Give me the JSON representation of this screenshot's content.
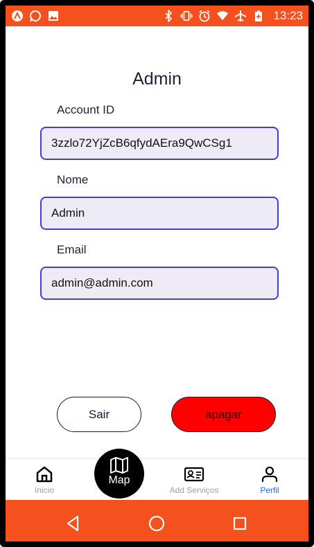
{
  "status_bar": {
    "time": "13:23",
    "left_icons": [
      "app-icon",
      "whatsapp-icon",
      "gallery-icon"
    ],
    "right_icons": [
      "bluetooth-icon",
      "vibrate-icon",
      "alarm-icon",
      "wifi-icon",
      "airplane-icon",
      "battery-icon"
    ],
    "color": "#f4511e"
  },
  "page": {
    "title": "Admin"
  },
  "form": {
    "account_id": {
      "label": "Account ID",
      "value": "3zzlo72YjZcB6qfydAEra9QwCSg1"
    },
    "nome": {
      "label": "Nome",
      "value": "Admin"
    },
    "email": {
      "label": "Email",
      "value": "admin@admin.com"
    }
  },
  "actions": {
    "sair_label": "Sair",
    "apagar_label": "apagar",
    "apagar_color": "#ff0000"
  },
  "tabs": {
    "inicio": "Inicio",
    "map": "Map",
    "add_servicos": "Add Serviços",
    "perfil": "Perfil",
    "active": "perfil",
    "active_color": "#1e6bff"
  },
  "system_nav": {
    "icons": [
      "back-icon",
      "home-icon",
      "recents-icon"
    ]
  }
}
